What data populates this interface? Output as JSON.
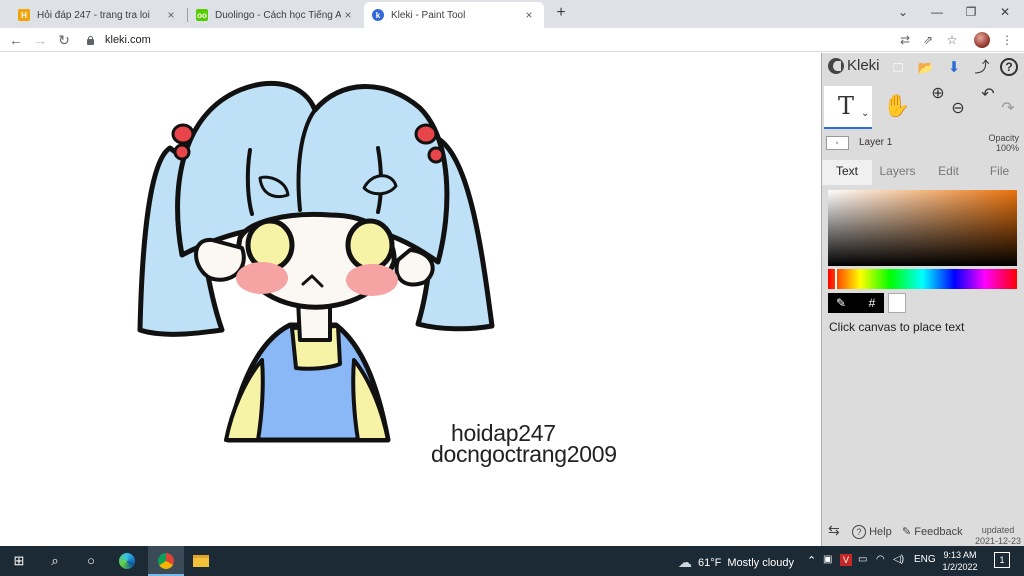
{
  "browser": {
    "tabs": [
      {
        "title": "Hỏi đáp 247 - trang tra loi",
        "favicon_color": "#f0a30a",
        "favicon_text": "H",
        "active": false
      },
      {
        "title": "Duolingo - Cách học Tiếng Anh t",
        "favicon_color": "#58cc02",
        "favicon_text": "oo",
        "active": false
      },
      {
        "title": "Kleki - Paint Tool",
        "favicon_color": "#3369d6",
        "favicon_text": "k",
        "active": true
      }
    ],
    "close_glyph": "×",
    "new_tab_glyph": "+",
    "url": "kleki.com",
    "window_controls": {
      "list": "⌄",
      "minimize": "—",
      "maximize": "❐",
      "close": "✕"
    },
    "nav": {
      "back": "←",
      "forward": "→",
      "reload": "↻"
    },
    "toolbar_icons": {
      "translate": "⇄",
      "share": "⇗",
      "bookmark": "☆",
      "menu": "⋮"
    }
  },
  "canvas": {
    "watermark_line1": "hoidap247",
    "watermark_line2": "docngoctrang2009",
    "colors": {
      "hair": "#bfe1f7",
      "clip": "#e8454a",
      "skin": "#fbf7f2",
      "blush": "#f5a3a3",
      "eyes": "#f7f3a6",
      "shirt": "#8ab8f7",
      "collar": "#f7f3a6",
      "outline": "#111111"
    }
  },
  "kleki": {
    "logo_text": "Kleki",
    "header_icons": {
      "new": "□",
      "open": "📂",
      "save": "⬇",
      "share": "⤴",
      "help": "?"
    },
    "tools": {
      "text": "T",
      "text_dropdown": "⌄",
      "hand": "✋",
      "zoom_in": "⊕",
      "zoom_out": "⊖",
      "undo": "↶",
      "redo": "↷"
    },
    "layer": {
      "thumb_text": "ₖ",
      "name": "Layer 1",
      "opacity_label": "Opacity",
      "opacity_value": "100%"
    },
    "tabs": [
      "Text",
      "Layers",
      "Edit",
      "File"
    ],
    "active_tab": "Text",
    "color": {
      "hue_hex": "#e8720c",
      "picker_dropper": "✎",
      "picker_hash": "#"
    },
    "hint": "Click canvas to place text",
    "bottom": {
      "swap": "⇆",
      "help_icon": "?",
      "help": "Help",
      "feedback_icon": "✎",
      "feedback": "Feedback",
      "updated_label": "updated",
      "updated_date": "2021-12-23"
    }
  },
  "taskbar": {
    "start": "⊞",
    "search": "⌕",
    "task_view": "○",
    "weather_icon": "☁",
    "weather_temp": "61°F",
    "weather_desc": "Mostly cloudy",
    "language": "ENG",
    "time": "9:13 AM",
    "date": "1/2/2022",
    "notifications": "1"
  }
}
